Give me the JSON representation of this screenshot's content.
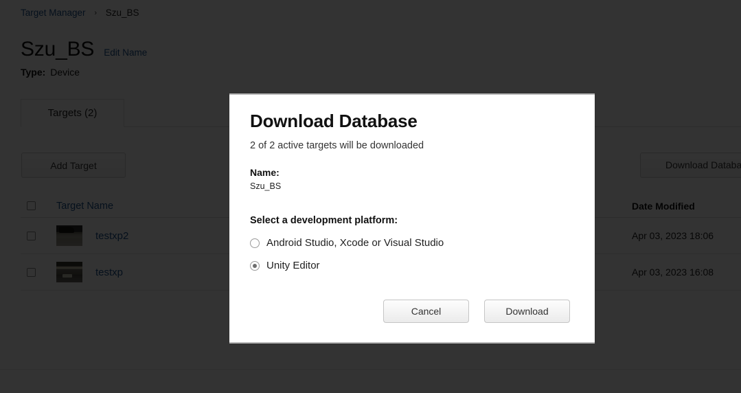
{
  "breadcrumb": {
    "parent": "Target Manager",
    "separator": "›",
    "current": "Szu_BS"
  },
  "header": {
    "title": "Szu_BS",
    "edit_name_label": "Edit Name",
    "type_label": "Type:",
    "type_value": "Device"
  },
  "tabs": [
    {
      "label": "Targets (2)"
    }
  ],
  "toolbar": {
    "add_target_label": "Add Target",
    "download_database_label": "Download Database"
  },
  "table": {
    "columns": {
      "name": "Target Name",
      "date_modified": "Date Modified"
    },
    "rows": [
      {
        "name": "testxp2",
        "date_modified": "Apr 03, 2023 18:06"
      },
      {
        "name": "testxp",
        "date_modified": "Apr 03, 2023 16:08"
      }
    ]
  },
  "modal": {
    "title": "Download Database",
    "subtitle": "2 of 2 active targets will be downloaded",
    "name_label": "Name:",
    "name_value": "Szu_BS",
    "platform_label": "Select a development platform:",
    "platform_options": [
      {
        "label": "Android Studio, Xcode or Visual Studio",
        "selected": false
      },
      {
        "label": "Unity Editor",
        "selected": true
      }
    ],
    "cancel_label": "Cancel",
    "download_label": "Download"
  },
  "colors": {
    "link": "#1b4f8a",
    "text": "#111111",
    "overlay": "rgba(0,0,0,0.80)",
    "border": "#dddddd"
  }
}
